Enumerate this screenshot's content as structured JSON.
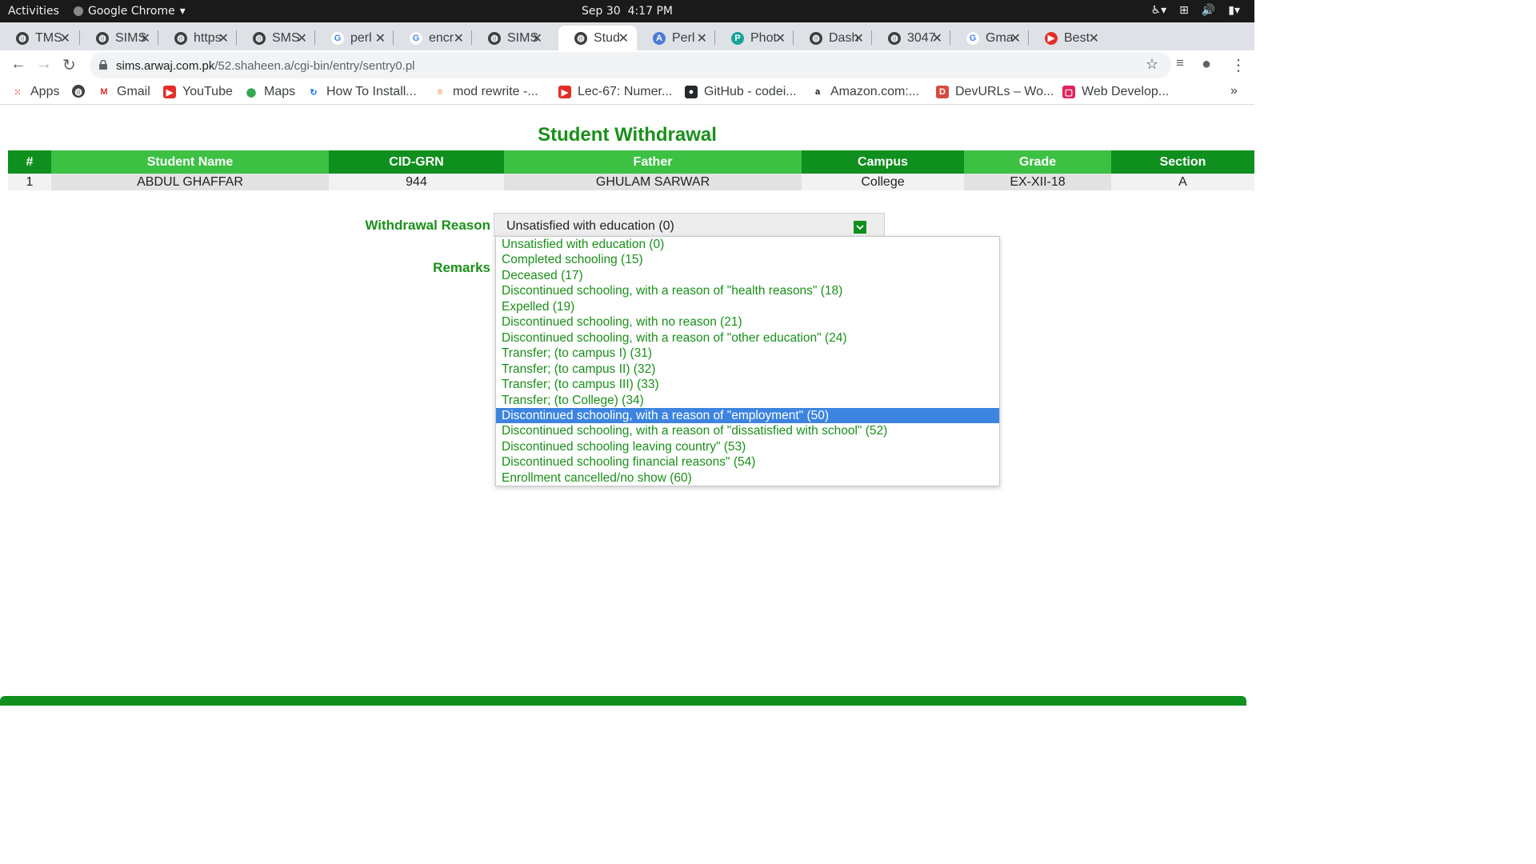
{
  "system": {
    "activities": "Activities",
    "app_name": "Google Chrome",
    "date": "Sep 30",
    "time": "4:17 PM"
  },
  "tabs": [
    {
      "title": "TMS",
      "icon": "globe-icon"
    },
    {
      "title": "SIMS",
      "icon": "globe-icon"
    },
    {
      "title": "https",
      "icon": "globe-icon"
    },
    {
      "title": "SMS",
      "icon": "globe-icon"
    },
    {
      "title": "perl",
      "icon": "google-icon"
    },
    {
      "title": "encr",
      "icon": "google-icon"
    },
    {
      "title": "SIMS",
      "icon": "globe-icon"
    },
    {
      "title": "Stud",
      "icon": "globe-icon",
      "active": true
    },
    {
      "title": "Perl",
      "icon": "a-icon"
    },
    {
      "title": "Phot",
      "icon": "photopea-icon"
    },
    {
      "title": "Dash",
      "icon": "globe-icon"
    },
    {
      "title": "3047",
      "icon": "globe-icon"
    },
    {
      "title": "Gma",
      "icon": "google-icon"
    },
    {
      "title": "Best",
      "icon": "youtube-icon"
    }
  ],
  "address": {
    "host": "sims.arwaj.com.pk",
    "path": "/52.shaheen.a/cgi-bin/entry/sentry0.pl"
  },
  "bookmarks": [
    {
      "label": "Apps",
      "icon": "apps-grid-icon"
    },
    {
      "label": "",
      "icon": "globe-icon"
    },
    {
      "label": "Gmail",
      "icon": "gmail-icon"
    },
    {
      "label": "YouTube",
      "icon": "youtube-icon"
    },
    {
      "label": "Maps",
      "icon": "maps-icon"
    },
    {
      "label": "How To Install...",
      "icon": "refresh-blue-icon"
    },
    {
      "label": "mod rewrite -...",
      "icon": "stackoverflow-icon"
    },
    {
      "label": "Lec-67: Numer...",
      "icon": "youtube-icon"
    },
    {
      "label": "GitHub - codei...",
      "icon": "github-icon"
    },
    {
      "label": "Amazon.com:...",
      "icon": "amazon-icon"
    },
    {
      "label": "DevURLs – Wo...",
      "icon": "devurls-icon"
    },
    {
      "label": "Web Develop...",
      "icon": "webdev-icon"
    }
  ],
  "page": {
    "title": "Student Withdrawal",
    "table": {
      "headers": [
        "#",
        "Student Name",
        "CID-GRN",
        "Father",
        "Campus",
        "Grade",
        "Section"
      ],
      "rows": [
        [
          "1",
          "ABDUL GHAFFAR",
          "944",
          "GHULAM SARWAR",
          "College",
          "EX-XII-18",
          "A"
        ]
      ]
    },
    "withdrawal_reason_label": "Withdrawal Reason",
    "remarks_label": "Remarks",
    "selected_reason": "Unsatisfied with education (0)",
    "reason_options": [
      "Unsatisfied with education (0)",
      "Completed schooling (15)",
      "Deceased (17)",
      "Discontinued schooling, with a reason of \"health reasons\" (18)",
      "Expelled (19)",
      "Discontinued schooling, with no reason (21)",
      "Discontinued schooling, with a reason of \"other education\" (24)",
      "Transfer; (to campus I) (31)",
      "Transfer; (to campus II) (32)",
      "Transfer; (to campus III) (33)",
      "Transfer; (to College) (34)",
      "Discontinued schooling, with a reason of \"employment\" (50)",
      "Discontinued schooling, with a reason of \"dissatisfied with school\" (52)",
      "Discontinued schooling leaving country\" (53)",
      "Discontinued schooling financial reasons\" (54)",
      "Enrollment cancelled/no show (60)"
    ],
    "highlighted_option": "Discontinued schooling, with a reason of \"employment\" (50)"
  },
  "colors": {
    "accent_green": "#1a8f1a",
    "header_dark_green": "#0f8f1d",
    "header_light_green": "#3cc143",
    "highlight_blue": "#3c84e0"
  }
}
